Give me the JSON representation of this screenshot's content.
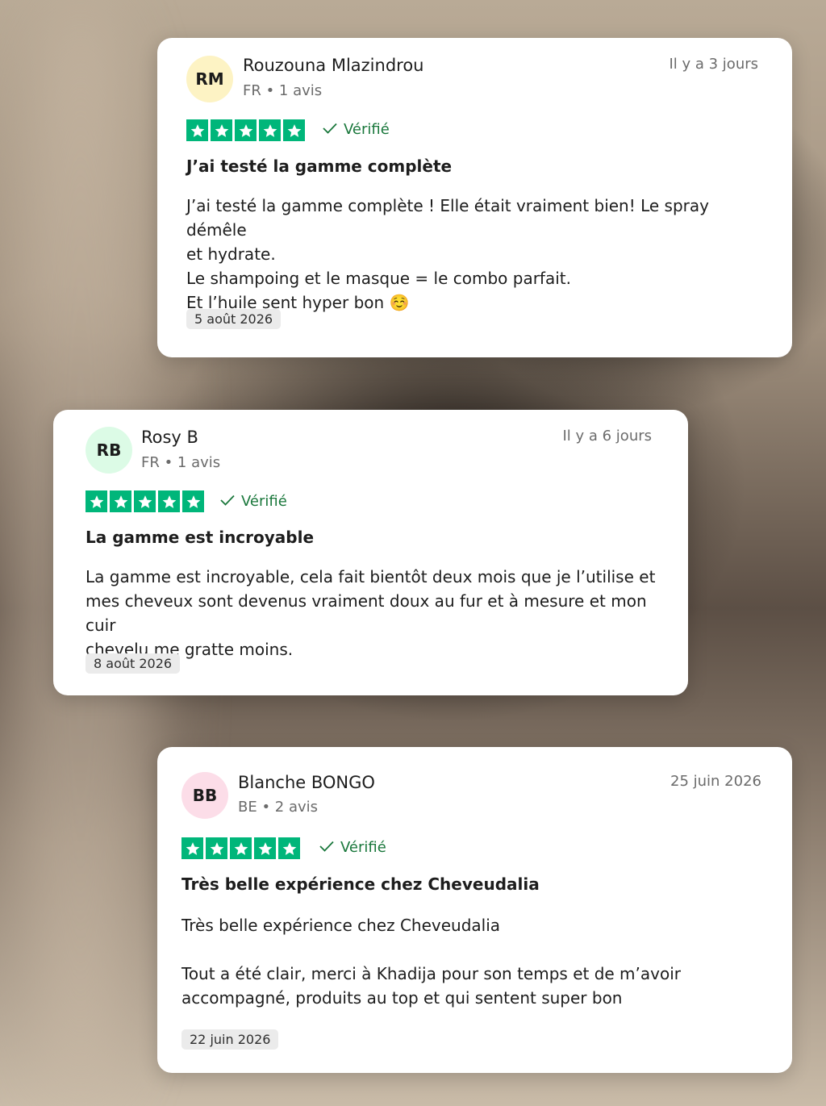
{
  "reviews": [
    {
      "initials": "RM",
      "avatar_color": "#fdf3c4",
      "name": "Rouzouna Mlazindrou",
      "meta": "FR • 1 avis",
      "relative_date": "Il y a 3 jours",
      "rating": 5,
      "verified_label": "Vérifié",
      "title": "J’ai testé la gamme complète",
      "body_lines": [
        "J’ai testé la gamme complète ! Elle était vraiment bien! Le spray démêle",
        "et hydrate.",
        "Le shampoing et le masque = le combo parfait.",
        "Et l’huile sent hyper bon ☺️"
      ],
      "experience_date": "5 août 2026"
    },
    {
      "initials": "RB",
      "avatar_color": "#dcfbe6",
      "name": "Rosy B",
      "meta": "FR • 1 avis",
      "relative_date": "Il y a 6 jours",
      "rating": 5,
      "verified_label": "Vérifié",
      "title": "La gamme est incroyable",
      "body_lines": [
        "La gamme est incroyable, cela fait bientôt deux mois que je l’utilise et",
        "mes cheveux sont devenus vraiment doux au fur et à mesure et mon cuir",
        "chevelu me gratte moins."
      ],
      "experience_date": "8 août 2026"
    },
    {
      "initials": "BB",
      "avatar_color": "#fcdde8",
      "name": "Blanche BONGO",
      "meta": "BE • 2 avis",
      "relative_date": "25 juin 2026",
      "rating": 5,
      "verified_label": "Vérifié",
      "title": "Très belle expérience chez Cheveudalia",
      "body_lines": [
        "Très belle expérience chez Cheveudalia",
        "",
        "Tout a été clair, merci à Khadija pour son temps et de m’avoir",
        "accompagné, produits au top et qui sentent super bon"
      ],
      "experience_date": "22 juin 2026"
    }
  ],
  "colors": {
    "star_green": "#00b67a",
    "verified_green": "#19773b"
  },
  "icons": {
    "star": "star-icon",
    "verified": "check-icon"
  }
}
